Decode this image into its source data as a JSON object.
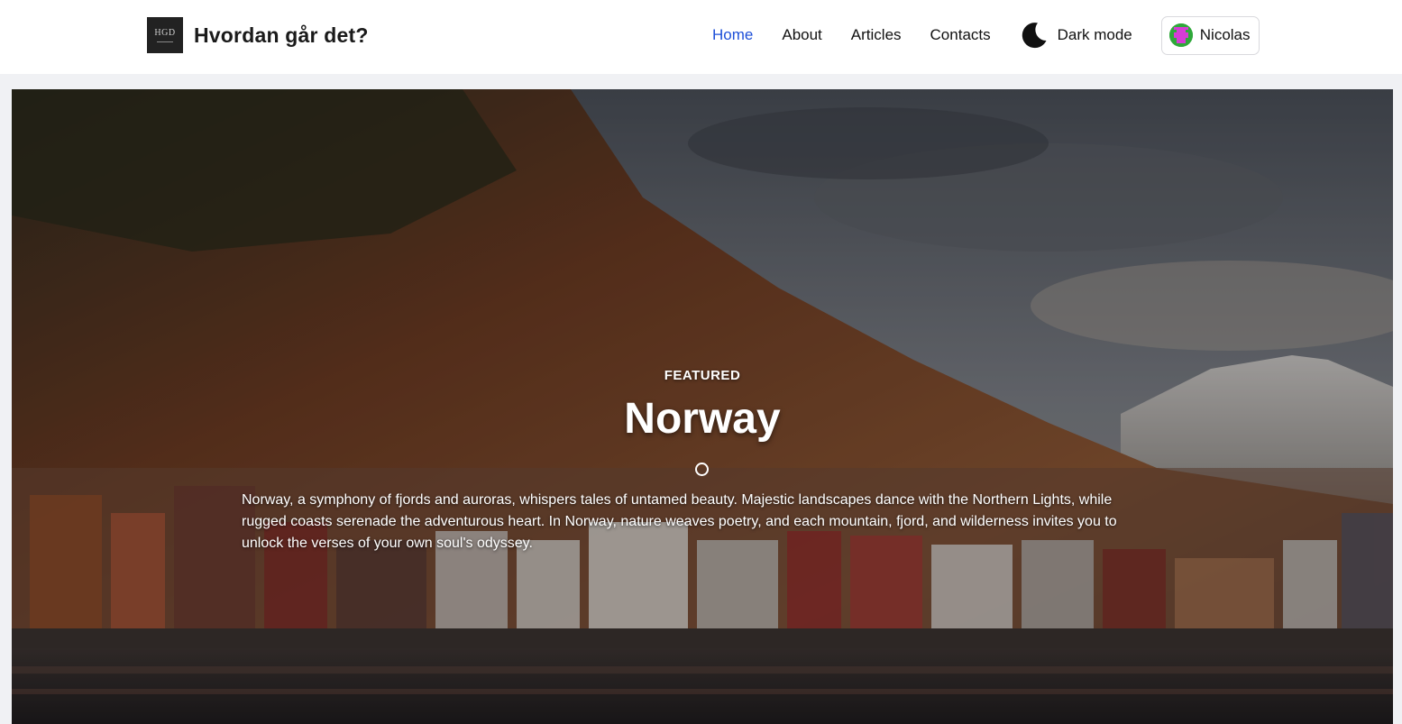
{
  "brand": {
    "logo_text": "HGD",
    "title": "Hvordan går det?"
  },
  "nav": {
    "items": [
      {
        "label": "Home",
        "active": true
      },
      {
        "label": "About",
        "active": false
      },
      {
        "label": "Articles",
        "active": false
      },
      {
        "label": "Contacts",
        "active": false
      }
    ],
    "dark_mode_label": "Dark mode",
    "user_name": "Nicolas"
  },
  "hero": {
    "kicker": "FEATURED",
    "title": "Norway",
    "description": "Norway, a symphony of fjords and auroras, whispers tales of untamed beauty. Majestic landscapes dance with the Northern Lights, while rugged coasts serenade the adventurous heart. In Norway, nature weaves poetry, and each mountain, fjord, and wilderness invites you to unlock the verses of your own soul's odyssey."
  },
  "colors": {
    "accent": "#1d4fd8",
    "nav_background": "#ffffff",
    "page_background": "#f0f1f4",
    "avatar_green": "#2fa83a",
    "avatar_magenta": "#d63cd6"
  },
  "icons": {
    "dark_mode": "moon-icon",
    "avatar": "pixel-avatar"
  }
}
